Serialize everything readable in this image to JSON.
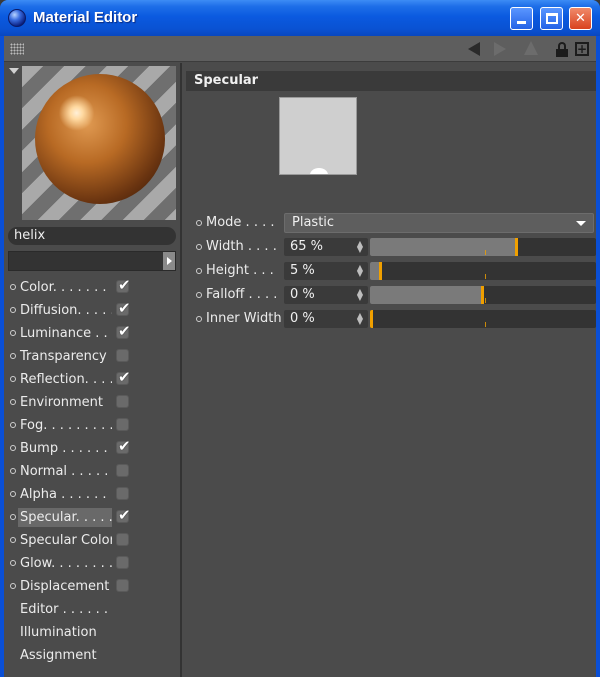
{
  "window": {
    "title": "Material Editor"
  },
  "material": {
    "name": "helix"
  },
  "channels": [
    {
      "label": "Color. . . . . . . .",
      "checked": true
    },
    {
      "label": "Diffusion. . . . . .",
      "checked": true
    },
    {
      "label": "Luminance . . .",
      "checked": true
    },
    {
      "label": "Transparency",
      "checked": false
    },
    {
      "label": "Reflection. . . .",
      "checked": true
    },
    {
      "label": "Environment",
      "checked": false
    },
    {
      "label": "Fog. . . . . . . . . .",
      "checked": false
    },
    {
      "label": "Bump . . . . . . .",
      "checked": true
    },
    {
      "label": "Normal . . . . . .",
      "checked": false
    },
    {
      "label": "Alpha . . . . . . .",
      "checked": false
    },
    {
      "label": "Specular. . . . .",
      "checked": true,
      "active": true
    },
    {
      "label": "Specular Color",
      "checked": false
    },
    {
      "label": "Glow. . . . . . . .",
      "checked": false
    },
    {
      "label": "Displacement",
      "checked": false
    }
  ],
  "extra_items": [
    {
      "label": "Editor . . . . . . ."
    },
    {
      "label": "Illumination"
    },
    {
      "label": "Assignment"
    }
  ],
  "panel": {
    "title": "Specular",
    "mode": {
      "label": "Mode . . . .",
      "value": "Plastic"
    },
    "params": [
      {
        "label": "Width . . . .",
        "value": "65 %",
        "fraction": 0.65
      },
      {
        "label": "Height  . . .",
        "value": "5 %",
        "fraction": 0.05
      },
      {
        "label": "Falloff . . . .",
        "value": "0 %",
        "fraction": 0.5
      },
      {
        "label": "Inner Width",
        "value": "0 %",
        "fraction": 0.0
      }
    ]
  },
  "colors": {
    "titlebar": "#0a52d3",
    "accent": "#f0a000",
    "panel": "#4b4b4b"
  }
}
